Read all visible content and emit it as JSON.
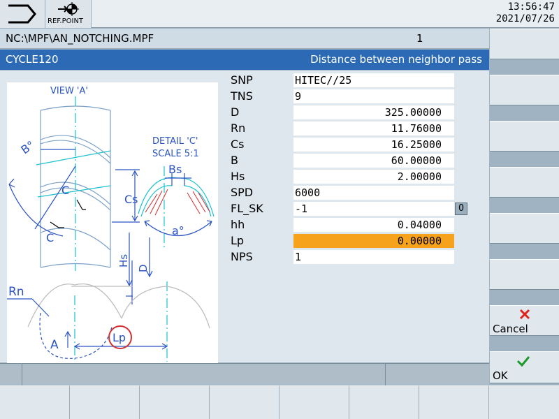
{
  "header": {
    "ref_point_label": "REF.POINT",
    "time": "13:56:47",
    "date": "2021/07/26"
  },
  "path": {
    "file": "NC:\\MPF\\AN_NOTCHING.MPF",
    "channel": "1"
  },
  "cycle": {
    "name": "CYCLE120",
    "hint": "Distance between neighbor pass"
  },
  "drawing": {
    "view_label": "VIEW 'A'",
    "detail_label_1": "DETAIL 'C'",
    "detail_label_2": "SCALE 5:1",
    "B": "B°",
    "Bs": "Bs",
    "C1": "C",
    "C2": "C",
    "Cs": "Cs",
    "a": "a°",
    "Hs": "Hs",
    "D": "D",
    "Rn": "Rn",
    "A": "A",
    "Lp": "Lp"
  },
  "params": [
    {
      "label": "SNP",
      "value": "HITEC//25"
    },
    {
      "label": "TNS",
      "value": "9"
    },
    {
      "label": "D",
      "value": "325.00000"
    },
    {
      "label": "Rn",
      "value": "11.76000"
    },
    {
      "label": "Cs",
      "value": "16.25000"
    },
    {
      "label": "B",
      "value": "60.00000"
    },
    {
      "label": "Hs",
      "value": "2.00000"
    },
    {
      "label": "SPD",
      "value": "6000"
    },
    {
      "label": "FL_SK",
      "value": "-1"
    },
    {
      "label": "hh",
      "value": "0.04000"
    },
    {
      "label": "Lp",
      "value": "0.00000"
    },
    {
      "label": "NPS",
      "value": "1"
    }
  ],
  "toggle_symbol": "O",
  "softkeys": {
    "cancel": "Cancel",
    "ok": "OK"
  },
  "colors": {
    "title_bar": "#2c6ab5",
    "selected_field": "#f7a21b",
    "cancel_icon": "#e0201a",
    "ok_icon": "#1e9a2c"
  }
}
